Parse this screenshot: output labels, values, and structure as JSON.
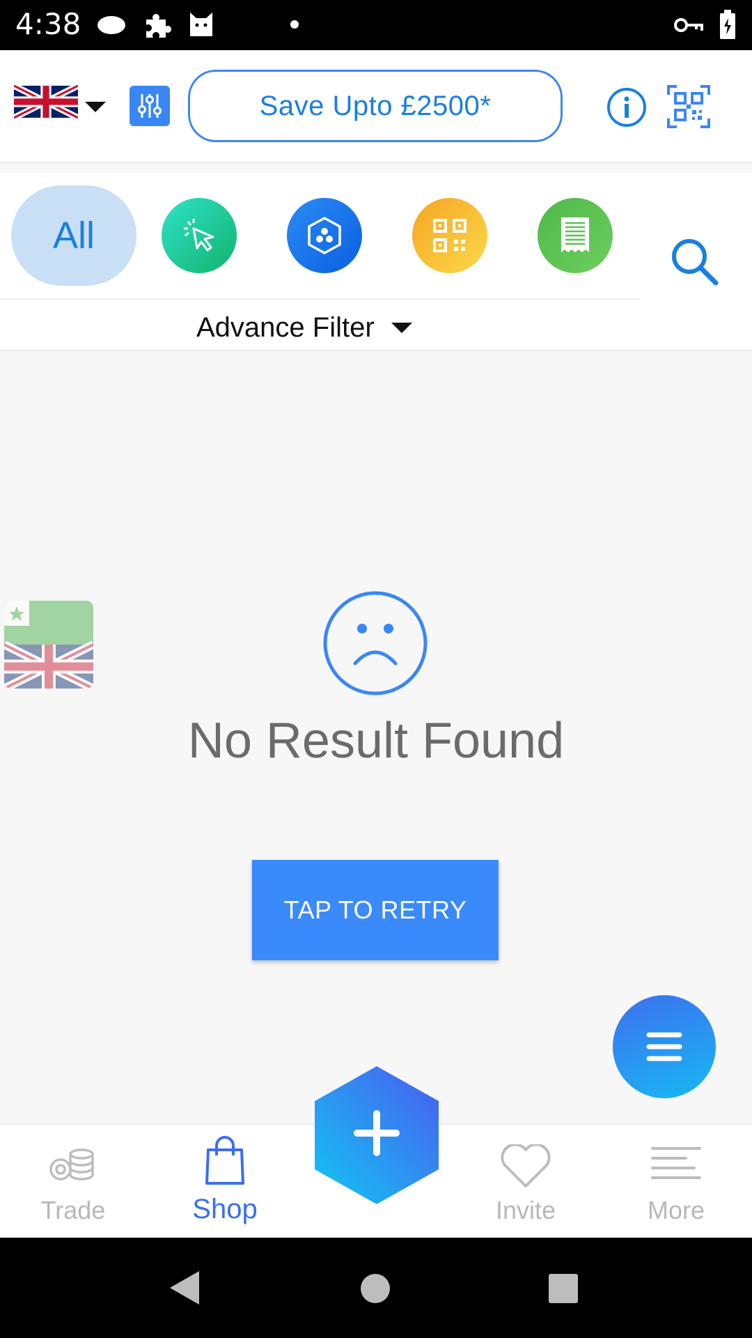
{
  "status_bar": {
    "time": "4:38"
  },
  "header": {
    "save_label": "Save Upto £2500*"
  },
  "categories": {
    "all_label": "All",
    "advance_filter_label": "Advance Filter",
    "colors": {
      "click": "#1fcf9c",
      "hex": "#1177ee",
      "qr": "#f7b92e",
      "receipt": "#5cbf56"
    }
  },
  "empty_state": {
    "message": "No Result Found",
    "retry_label": "TAP TO RETRY"
  },
  "bottom_nav": {
    "items": [
      {
        "label": "Trade",
        "icon": "coins-icon"
      },
      {
        "label": "Shop",
        "icon": "shopping-bag-icon"
      },
      {
        "label": "Invite",
        "icon": "heart-icon"
      },
      {
        "label": "More",
        "icon": "lines-icon"
      }
    ],
    "active": "Shop"
  },
  "colors": {
    "accent": "#3a8afb",
    "text_dark": "#111111",
    "muted": "#6b6b6b"
  }
}
